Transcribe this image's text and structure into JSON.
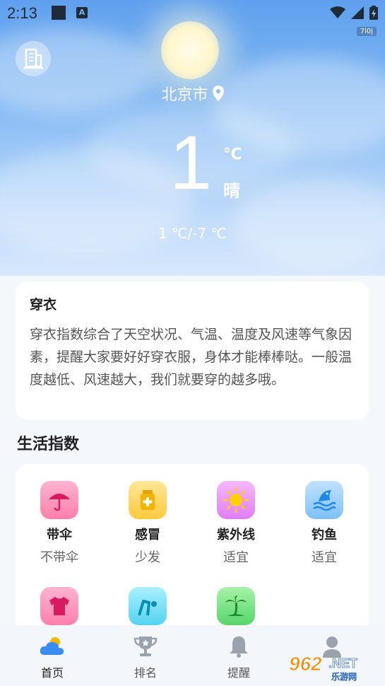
{
  "status_bar": {
    "time": "2:13",
    "net_badge": "7l0j",
    "a_icon": "A"
  },
  "hero": {
    "city": "北京市",
    "temperature": "1",
    "unit": "℃",
    "condition": "晴",
    "range": "1 ℃/-7 ℃"
  },
  "dressing": {
    "title": "穿衣",
    "description": "穿衣指数综合了天空状况、气温、温度及风速等气象因素，提醒大家要好好穿衣服，身体才能棒棒哒。一般温度越低、风速越大，我们就要穿的越多哦。"
  },
  "life_index": {
    "title": "生活指数",
    "items": [
      {
        "name": "带伞",
        "value": "不带伞",
        "icon": "umbrella-icon"
      },
      {
        "name": "感冒",
        "value": "少发",
        "icon": "medicine-icon"
      },
      {
        "name": "紫外线",
        "value": "适宜",
        "icon": "uv-sun-icon"
      },
      {
        "name": "钓鱼",
        "value": "适宜",
        "icon": "fish-icon"
      },
      {
        "name": "",
        "value": "",
        "icon": "clothes-icon"
      },
      {
        "name": "",
        "value": "",
        "icon": "exercise-icon"
      },
      {
        "name": "",
        "value": "",
        "icon": "palm-tree-icon"
      }
    ]
  },
  "tabs": [
    {
      "label": "首页",
      "icon": "weather-icon",
      "active": true
    },
    {
      "label": "排名",
      "icon": "trophy-icon",
      "active": false
    },
    {
      "label": "提醒",
      "icon": "bell-icon",
      "active": false
    },
    {
      "label": "",
      "icon": "profile-icon",
      "active": false
    }
  ],
  "watermark": {
    "text": "962.NET",
    "subtext": "乐游网"
  },
  "colors": {
    "sky_top": "#5fa0ee",
    "sky_bottom": "#d7e8fc",
    "active_tab": "#3b8cf0"
  }
}
